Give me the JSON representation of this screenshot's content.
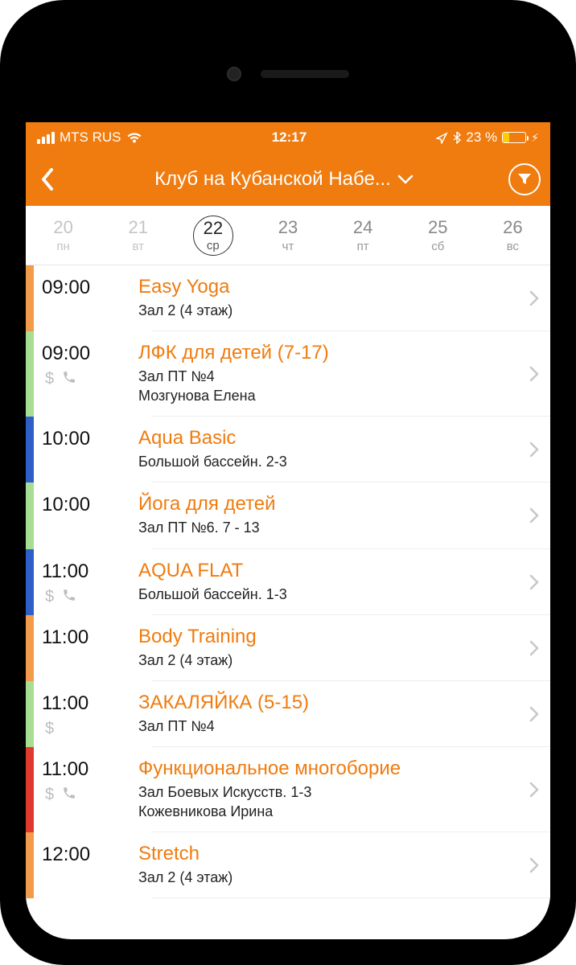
{
  "status": {
    "carrier": "MTS RUS",
    "time": "12:17",
    "battery_pct": "23 %"
  },
  "header": {
    "title": "Клуб на Кубанской Набе..."
  },
  "dates": [
    {
      "num": "20",
      "dow": "пн",
      "state": "past"
    },
    {
      "num": "21",
      "dow": "вт",
      "state": "past"
    },
    {
      "num": "22",
      "dow": "ср",
      "state": "selected"
    },
    {
      "num": "23",
      "dow": "чт",
      "state": ""
    },
    {
      "num": "24",
      "dow": "пт",
      "state": ""
    },
    {
      "num": "25",
      "dow": "сб",
      "state": ""
    },
    {
      "num": "26",
      "dow": "вс",
      "state": ""
    }
  ],
  "schedule": [
    {
      "time": "09:00",
      "title": "Easy Yoga",
      "sub": "Зал 2 (4 этаж)",
      "trainer": "",
      "color": "orange",
      "paid": false,
      "phone": false
    },
    {
      "time": "09:00",
      "title": "ЛФК для детей (7-17)",
      "sub": "Зал ПТ №4",
      "trainer": "Мозгунова Елена",
      "color": "green",
      "paid": true,
      "phone": true
    },
    {
      "time": "10:00",
      "title": "Aqua Basic",
      "sub": "Большой бассейн. 2-3",
      "trainer": "",
      "color": "blue",
      "paid": false,
      "phone": false
    },
    {
      "time": "10:00",
      "title": "Йога для детей",
      "sub": "Зал ПТ №6. 7 - 13",
      "trainer": "",
      "color": "green",
      "paid": false,
      "phone": false
    },
    {
      "time": "11:00",
      "title": "AQUA FLAT",
      "sub": "Большой бассейн. 1-3",
      "trainer": "",
      "color": "blue",
      "paid": true,
      "phone": true
    },
    {
      "time": "11:00",
      "title": "Body Training",
      "sub": "Зал 2 (4 этаж)",
      "trainer": "",
      "color": "orange",
      "paid": false,
      "phone": false
    },
    {
      "time": "11:00",
      "title": "ЗАКАЛЯЙКА (5-15)",
      "sub": "Зал ПТ №4",
      "trainer": "",
      "color": "green",
      "paid": true,
      "phone": false
    },
    {
      "time": "11:00",
      "title": "Функциональное многоборие",
      "sub": "Зал Боевых Искусств. 1-3",
      "trainer": "Кожевникова Ирина",
      "color": "red",
      "paid": true,
      "phone": true
    },
    {
      "time": "12:00",
      "title": "Stretch",
      "sub": "Зал 2 (4 этаж)",
      "trainer": "",
      "color": "orange",
      "paid": false,
      "phone": false
    }
  ]
}
